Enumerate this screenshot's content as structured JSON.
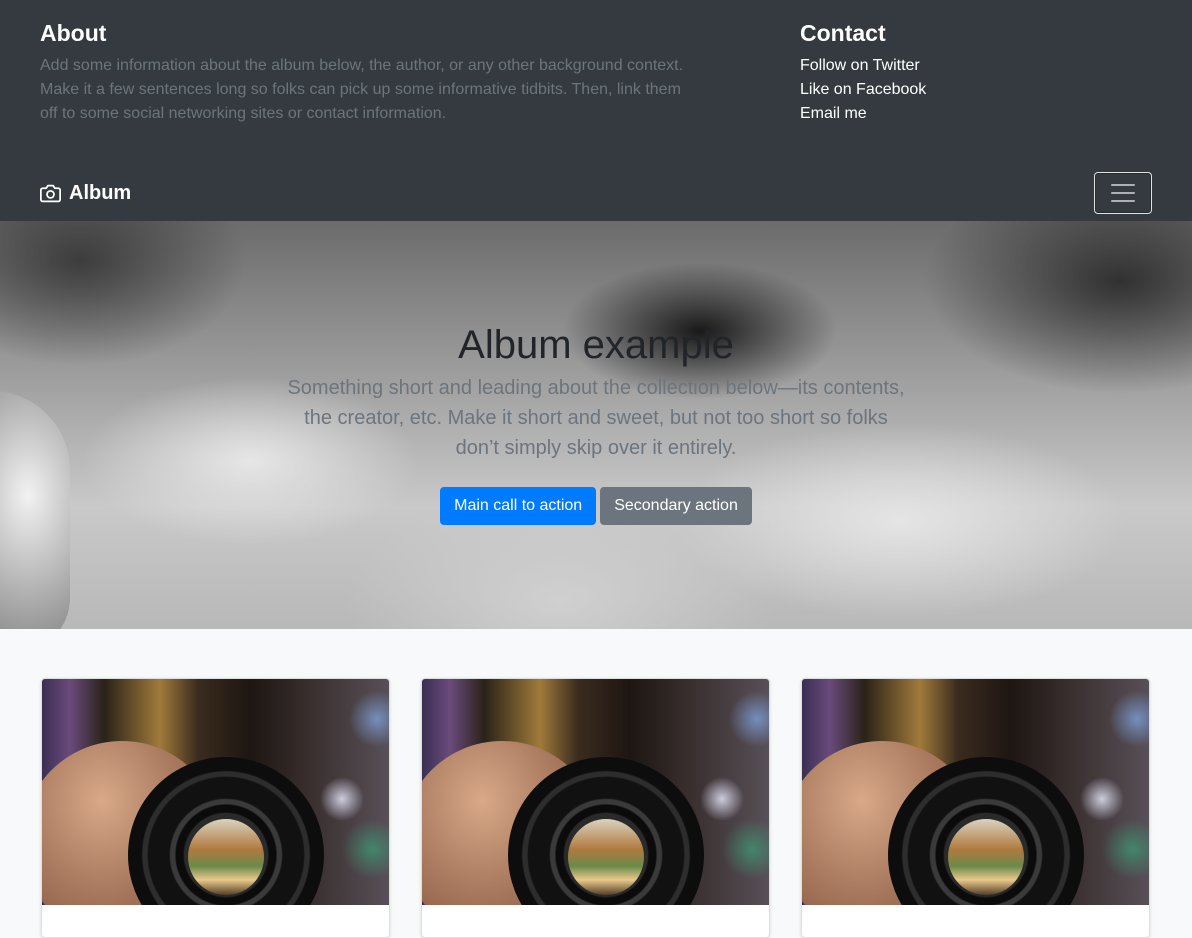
{
  "header": {
    "about": {
      "title": "About",
      "text": "Add some information about the album below, the author, or any other background context. Make it a few sentences long so folks can pick up some informative tidbits. Then, link them off to some social networking sites or contact information."
    },
    "contact": {
      "title": "Contact",
      "links": [
        "Follow on Twitter",
        "Like on Facebook",
        "Email me"
      ]
    }
  },
  "navbar": {
    "brand": "Album",
    "brand_icon": "camera-icon",
    "toggler_icon": "hamburger-menu-icon"
  },
  "hero": {
    "title": "Album example",
    "lead": "Something short and leading about the collection below—its contents, the creator, etc. Make it short and sweet, but not too short so folks don’t simply skip over it entirely.",
    "primary_label": "Main call to action",
    "secondary_label": "Secondary action"
  },
  "album": {
    "cards": [
      {
        "image": "camera-lens-photo"
      },
      {
        "image": "camera-lens-photo"
      },
      {
        "image": "camera-lens-photo"
      }
    ]
  },
  "colors": {
    "header_bg": "#343a40",
    "primary": "#007bff",
    "secondary": "#6c757d",
    "album_bg": "#f8f9fa"
  }
}
